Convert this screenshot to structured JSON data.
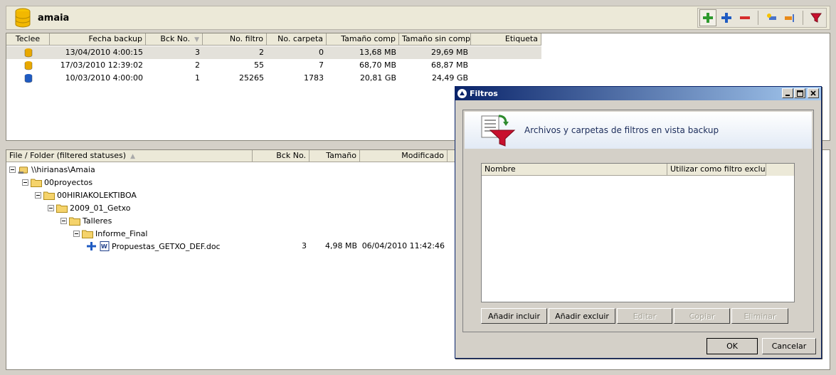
{
  "header": {
    "title": "amaia"
  },
  "backups": {
    "columns": [
      "Teclee",
      "Fecha backup",
      "Bck No.",
      "No. filtro",
      "No. carpeta",
      "Tamaño comp",
      "Tamaño sin compr",
      "Etiqueta"
    ],
    "rows": [
      {
        "date": "13/04/2010 4:00:15",
        "bck": "3",
        "filtro": "2",
        "carpeta": "0",
        "comp": "13,68 MB",
        "sincomp": "29,69 MB",
        "label": ""
      },
      {
        "date": "17/03/2010 12:39:02",
        "bck": "2",
        "filtro": "55",
        "carpeta": "7",
        "comp": "68,70 MB",
        "sincomp": "68,87 MB",
        "label": ""
      },
      {
        "date": "10/03/2010 4:00:00",
        "bck": "1",
        "filtro": "25265",
        "carpeta": "1783",
        "comp": "20,81 GB",
        "sincomp": "24,49 GB",
        "label": ""
      }
    ]
  },
  "files": {
    "columns": [
      "File / Folder (filtered statuses)",
      "Bck No.",
      "Tamaño",
      "Modificado"
    ],
    "tree": [
      {
        "name": "\\\\hirianas\\Amaia",
        "type": "share"
      },
      {
        "name": "00proyectos",
        "type": "folder"
      },
      {
        "name": "00HIRIAKOLEKTIBOA",
        "type": "folder"
      },
      {
        "name": "2009_01_Getxo",
        "type": "folder"
      },
      {
        "name": "Talleres",
        "type": "folder"
      },
      {
        "name": "Informe_Final",
        "type": "folder"
      },
      {
        "name": "Propuestas_GETXO_DEF.doc",
        "type": "file",
        "bck": "3",
        "size": "4,98 MB",
        "modified": "06/04/2010 11:42:46"
      }
    ]
  },
  "dialog": {
    "title": "Filtros",
    "banner": "Archivos y carpetas de filtros en vista backup",
    "columns": [
      "Nombre",
      "Utilizar como filtro exclu..."
    ],
    "buttons": {
      "add_include": "Añadir incluir",
      "add_exclude": "Añadir excluir",
      "edit": "Editar",
      "copy": "Copiar",
      "delete": "Eliminar",
      "ok": "OK",
      "cancel": "Cancelar"
    }
  },
  "colors": {
    "selection": "#e3e1da",
    "title_gradient_start": "#0a246a",
    "title_gradient_end": "#a6caf0"
  }
}
